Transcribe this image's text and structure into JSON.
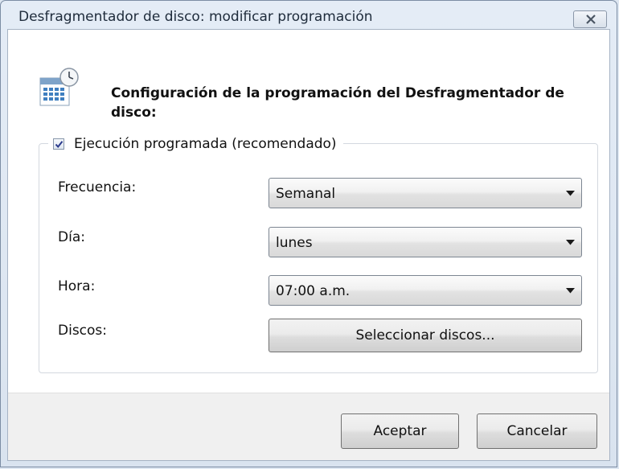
{
  "window": {
    "title": "Desfragmentador de disco: modificar programación"
  },
  "header": {
    "icon": "calendar-clock-icon",
    "text": "Configuración de la programación del Desfragmentador de disco:"
  },
  "schedule": {
    "enabled_label": "Ejecución programada (recomendado)",
    "enabled": true
  },
  "fields": {
    "frequency": {
      "label": "Frecuencia:",
      "value": "Semanal"
    },
    "day": {
      "label": "Día:",
      "value": "lunes"
    },
    "time": {
      "label": "Hora:",
      "value": "07:00 a.m."
    },
    "disks": {
      "label": "Discos:",
      "button_label": "Seleccionar discos..."
    }
  },
  "buttons": {
    "ok": "Aceptar",
    "cancel": "Cancelar"
  }
}
